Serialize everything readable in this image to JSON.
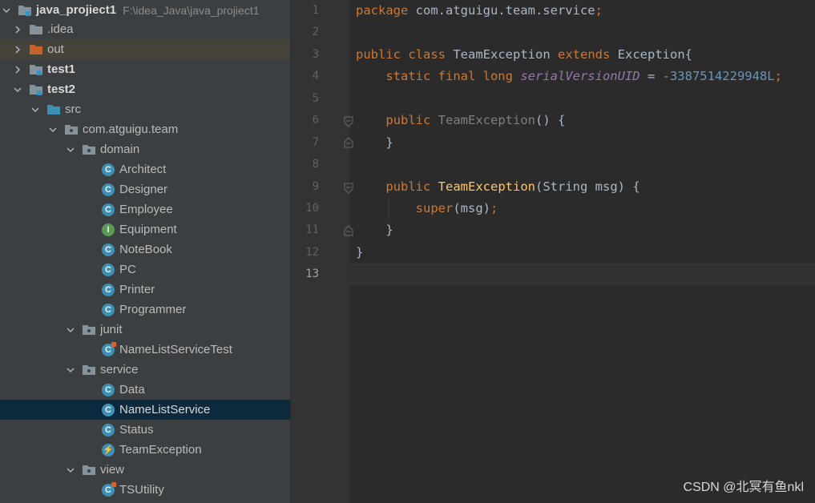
{
  "project": {
    "name": "java_projiect1",
    "path": "F:\\idea_Java\\java_projiect1"
  },
  "tree": [
    {
      "label": "java_projiect1",
      "kind": "module",
      "bold": true,
      "expanded": true
    },
    {
      "label": ".idea",
      "kind": "folder-gray"
    },
    {
      "label": "out",
      "kind": "folder-orange"
    },
    {
      "label": "test1",
      "kind": "module",
      "bold": true
    },
    {
      "label": "test2",
      "kind": "module",
      "bold": true,
      "expanded": true
    },
    {
      "label": "src",
      "kind": "folder-src",
      "expanded": true
    },
    {
      "label": "com.atguigu.team",
      "kind": "package",
      "expanded": true
    },
    {
      "label": "domain",
      "kind": "package",
      "expanded": true
    },
    {
      "label": "Architect",
      "kind": "class"
    },
    {
      "label": "Designer",
      "kind": "class"
    },
    {
      "label": "Employee",
      "kind": "class"
    },
    {
      "label": "Equipment",
      "kind": "interface"
    },
    {
      "label": "NoteBook",
      "kind": "class"
    },
    {
      "label": "PC",
      "kind": "class"
    },
    {
      "label": "Printer",
      "kind": "class"
    },
    {
      "label": "Programmer",
      "kind": "class"
    },
    {
      "label": "junit",
      "kind": "package",
      "expanded": true
    },
    {
      "label": "NameListServiceTest",
      "kind": "test"
    },
    {
      "label": "service",
      "kind": "package",
      "expanded": true
    },
    {
      "label": "Data",
      "kind": "class"
    },
    {
      "label": "NameListService",
      "kind": "class",
      "selected": true
    },
    {
      "label": "Status",
      "kind": "class"
    },
    {
      "label": "TeamException",
      "kind": "exception"
    },
    {
      "label": "view",
      "kind": "package",
      "expanded": true
    },
    {
      "label": "TSUtility",
      "kind": "test"
    }
  ],
  "editor": {
    "current_line": 13,
    "lines": [
      {
        "n": "1"
      },
      {
        "n": "2"
      },
      {
        "n": "3"
      },
      {
        "n": "4"
      },
      {
        "n": "5"
      },
      {
        "n": "6"
      },
      {
        "n": "7"
      },
      {
        "n": "8"
      },
      {
        "n": "9"
      },
      {
        "n": "10"
      },
      {
        "n": "11"
      },
      {
        "n": "12"
      },
      {
        "n": "13"
      }
    ],
    "code": {
      "l1_kw": "package",
      "l1_rest": " com.atguigu.team.service",
      "l1_semi": ";",
      "l3_kw1": "public",
      "l3_kw2": "class",
      "l3_name": " TeamException ",
      "l3_kw3": "extends",
      "l3_rest": " Exception{",
      "l4_kw": "static final long",
      "l4_field": "serialVersionUID",
      "l4_eq": " = ",
      "l4_num": "-3387514229948L",
      "l4_semi": ";",
      "l6_kw": "public",
      "l6_name": "TeamException",
      "l6_rest": "() {",
      "l7": "}",
      "l9_kw": "public",
      "l9_name": "TeamException",
      "l9_rest": "(String msg) {",
      "l10_kw": "super",
      "l10_rest": "(msg)",
      "l10_semi": ";",
      "l11": "}",
      "l12": "}"
    }
  },
  "watermark": "CSDN @北冥有鱼nkl",
  "colors": {
    "tree_bg": "#3c3f41",
    "editor_bg": "#2b2b2b",
    "selection": "#0d293e",
    "keyword": "#cc7832",
    "function": "#ffc66d",
    "field": "#9876aa",
    "number": "#6897bb"
  }
}
